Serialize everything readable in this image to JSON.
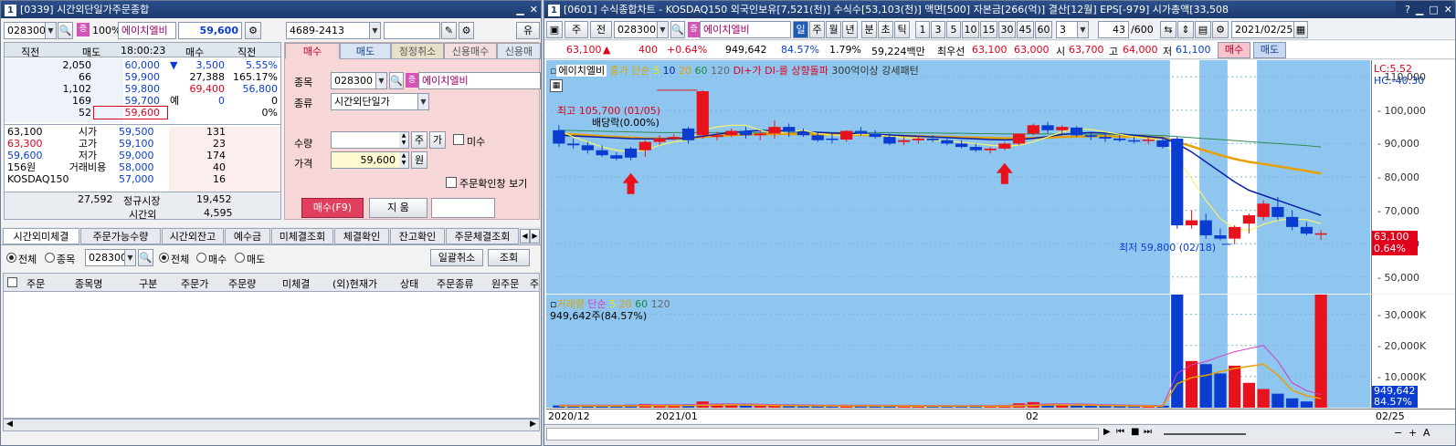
{
  "left": {
    "title": "[0339] 시간외단일가주문종합",
    "code": "028300",
    "pct100": "100%",
    "name": "에이치엘비",
    "price": "59,600",
    "acct": "4689-2413",
    "gubun": "유",
    "hdr": [
      "직전",
      "매도",
      "18:00:23",
      "매수",
      "직전"
    ],
    "ask_rows": [
      [
        "",
        "2,050",
        "60,000",
        "▼",
        "3,500",
        "5.55%"
      ],
      [
        "",
        "66",
        "59,900",
        "",
        "27,388",
        "165.17%"
      ],
      [
        "",
        "1,102",
        "59,800",
        "",
        "69,400",
        "56,800"
      ],
      [
        "",
        "169",
        "59,700",
        "예",
        "0",
        "0"
      ],
      [
        "",
        "52",
        "59,600",
        "",
        "",
        "0%"
      ]
    ],
    "info_rows": [
      [
        "63,100",
        "시가",
        "59,500",
        "131"
      ],
      [
        "63,300",
        "고가",
        "59,100",
        "23"
      ],
      [
        "59,600",
        "저가",
        "59,000",
        "174"
      ],
      [
        "156원",
        "거래비용",
        "58,000",
        "40"
      ],
      [
        "KOSDAQ150",
        "",
        "57,000",
        "16"
      ]
    ],
    "tot_ask": "27,592",
    "tot_label": "정규시장",
    "tot_bid": "19,452",
    "after_label": "시간외",
    "after_val": "4,595",
    "order_tabs": [
      "매수",
      "매도",
      "정정취소",
      "신용매수",
      "신용매"
    ],
    "f_code_label": "종목",
    "f_code": "028300",
    "f_name": "에이치엘비",
    "f_type_label": "종류",
    "f_type": "시간외단일가",
    "f_qty_label": "수량",
    "f_qty_unit": "주",
    "f_qty_ga": "가",
    "f_mi": "미수",
    "f_price_label": "가격",
    "f_price": "59,600",
    "f_price_unit": "원",
    "f_confirm": "주문확인창 보기",
    "buy_btn": "매수(F9)",
    "clear_btn": "지 움",
    "btabs": [
      "시간외미체결",
      "주문가능수량",
      "시간외잔고",
      "예수금",
      "미체결조회",
      "체결확인",
      "잔고확인",
      "주문체결조회"
    ],
    "filter": {
      "all": "전체",
      "stock": "종목",
      "code": "028300",
      "all2": "전체",
      "buy": "매수",
      "sell": "매도",
      "cancel_all": "일괄취소",
      "query": "조회"
    },
    "cols": [
      "주문",
      "종목명",
      "구분",
      "주문가",
      "주문량",
      "미체결",
      "(외)현재가",
      "상태",
      "주문종류",
      "원주문",
      "주"
    ]
  },
  "right": {
    "title": "[0601] 수식종합차트 - KOSDAQ150 외국인보유[7,521(천)] 수식수[53,103(천)] 액면[500] 자본금[266(억)] 결산[12월] EPS[-979] 시가총액[33,508",
    "tb": {
      "ju": "주",
      "jeon": "전",
      "code": "028300",
      "name": "에이치엘비",
      "periods": [
        "일",
        "주",
        "월",
        "년",
        "분",
        "초",
        "틱"
      ],
      "nums": [
        "1",
        "3",
        "5",
        "10",
        "15",
        "30",
        "45",
        "60"
      ],
      "n3": "3",
      "page": "43",
      "pageof": "/600",
      "date": "2021/02/25"
    },
    "q": {
      "price": "63,100",
      "arrow": "▲",
      "chg": "400",
      "chgpct": "+0.64%",
      "vol": "949,642",
      "volpct": "84.57%",
      "r1": "1.79%",
      "amt": "59,224백만",
      "best_label": "최우선",
      "b1": "63,100",
      "b2": "63,000",
      "o_label": "시",
      "o": "63,700",
      "h_label": "고",
      "h": "64,000",
      "l_label": "저",
      "l": "61,100",
      "buy": "매수",
      "sell": "매도"
    },
    "legend": {
      "name": "에이치엘비",
      "close": "종가 단순",
      "ma": [
        "5",
        "10",
        "20",
        "60",
        "120"
      ],
      "di": "DI+가 DI-를 상향돌파",
      "pat": "300억이상 강세패턴"
    },
    "lc": "LC:5.52",
    "hc": "HC:-40.30",
    "ann": {
      "high": "최고 105,700 (01/05)",
      "div": "배당락(0.00%)",
      "low": "최저 59,800 (02/18)",
      "last": "63,100",
      "lastpct": "0.64%"
    },
    "vlegend": {
      "label": "거래량",
      "simple": "단순",
      "ma": [
        "5",
        "20",
        "60",
        "120"
      ],
      "val": "949,642주(84.57%)"
    },
    "vlast": "949,642",
    "vpct": "84.57%",
    "xlabels": [
      "2020/12",
      "2021/01",
      "02",
      "02/25"
    ]
  },
  "chart_data": {
    "type": "candlestick",
    "title": "",
    "ylim": [
      45000,
      115000
    ],
    "y_ticks": [
      50000,
      60000,
      70000,
      80000,
      90000,
      100000,
      110000
    ],
    "y_tick_labels": [
      "50,000",
      "60,000",
      "70,000",
      "80,000",
      "90,000",
      "100,000",
      "110,000"
    ],
    "x_labels": [
      "2020/12",
      "2021/01",
      "02",
      "02/25"
    ],
    "candles": [
      [
        94000,
        95500,
        89000,
        90000
      ],
      [
        90000,
        91500,
        88500,
        89500
      ],
      [
        89500,
        90500,
        87000,
        88000
      ],
      [
        88000,
        89500,
        86000,
        86500
      ],
      [
        86500,
        87500,
        85000,
        85500
      ],
      [
        88500,
        89000,
        85000,
        85800
      ],
      [
        88000,
        91000,
        86000,
        90500
      ],
      [
        90500,
        92500,
        89500,
        91500
      ],
      [
        91500,
        92800,
        91000,
        92000
      ],
      [
        94500,
        95000,
        90000,
        91000
      ],
      [
        92500,
        106000,
        91500,
        105700
      ],
      [
        92000,
        93500,
        91000,
        92500
      ],
      [
        92500,
        94500,
        92000,
        93800
      ],
      [
        93800,
        95000,
        91500,
        92500
      ],
      [
        92500,
        94000,
        91000,
        93000
      ],
      [
        93000,
        97000,
        91500,
        95000
      ],
      [
        95000,
        96000,
        92000,
        93500
      ],
      [
        93500,
        94500,
        92000,
        92500
      ],
      [
        92500,
        93500,
        90500,
        91000
      ],
      [
        91500,
        93000,
        90000,
        91200
      ],
      [
        91200,
        94000,
        90500,
        93800
      ],
      [
        93800,
        95000,
        92500,
        93000
      ],
      [
        93000,
        94000,
        91500,
        92000
      ],
      [
        92000,
        93000,
        89500,
        90000
      ],
      [
        90500,
        92000,
        89500,
        91000
      ],
      [
        91000,
        92500,
        90000,
        91500
      ],
      [
        91500,
        92500,
        90500,
        91000
      ],
      [
        91000,
        92000,
        89500,
        90000
      ],
      [
        90000,
        91000,
        88500,
        89000
      ],
      [
        89000,
        90000,
        87500,
        88000
      ],
      [
        88000,
        89000,
        87000,
        88500
      ],
      [
        88500,
        90500,
        88000,
        90000
      ],
      [
        90000,
        93000,
        89500,
        93000
      ],
      [
        93000,
        96000,
        92500,
        95500
      ],
      [
        95500,
        96500,
        93000,
        94000
      ],
      [
        94000,
        95500,
        93000,
        95000
      ],
      [
        94800,
        95200,
        92000,
        92500
      ],
      [
        92500,
        93000,
        91000,
        92000
      ],
      [
        92000,
        93000,
        90500,
        91500
      ],
      [
        91500,
        92500,
        90500,
        91000
      ],
      [
        91000,
        92000,
        90000,
        90800
      ],
      [
        90800,
        91800,
        89800,
        91200
      ],
      [
        91000,
        92000,
        88500,
        89000
      ],
      [
        91500,
        92000,
        64500,
        65500
      ],
      [
        65500,
        70000,
        64500,
        67000
      ],
      [
        67000,
        69000,
        61500,
        62500
      ],
      [
        62500,
        64500,
        61000,
        61500
      ],
      [
        61500,
        65500,
        59800,
        65000
      ],
      [
        66000,
        69000,
        63000,
        68500
      ],
      [
        68000,
        73000,
        67000,
        72000
      ],
      [
        71000,
        74000,
        67000,
        68000
      ],
      [
        68000,
        70000,
        64000,
        65000
      ],
      [
        65000,
        66500,
        62500,
        63000
      ],
      [
        63000,
        64000,
        61100,
        63100
      ]
    ],
    "ma5": [
      94000,
      92000,
      90500,
      89000,
      88000,
      87500,
      88000,
      89500,
      90500,
      91000,
      94000,
      95000,
      95500,
      95500,
      94000,
      93000,
      93500,
      94000,
      93000,
      92500,
      92500,
      92800,
      92600,
      92200,
      91800,
      91500,
      91000,
      90800,
      90400,
      90000,
      89500,
      89200,
      89500,
      90500,
      92000,
      93500,
      94500,
      94200,
      93500,
      92800,
      92000,
      91500,
      91000,
      85500,
      79500,
      73000,
      67500,
      64500,
      64000,
      65800,
      67000,
      67400,
      67200,
      66000
    ],
    "ma20": [
      93000,
      92800,
      92500,
      92200,
      92000,
      91800,
      91600,
      91500,
      91500,
      91600,
      92000,
      92300,
      92500,
      92700,
      92800,
      92900,
      92900,
      92900,
      92800,
      92700,
      92600,
      92600,
      92500,
      92400,
      92300,
      92200,
      92100,
      92000,
      91900,
      91800,
      91700,
      91600,
      91600,
      91700,
      91800,
      92000,
      92100,
      92200,
      92200,
      92100,
      92000,
      91900,
      91800,
      90500,
      89200,
      87800,
      86500,
      85400,
      84500,
      83900,
      83200,
      82500,
      81800,
      81000
    ],
    "ma60": [
      94000,
      93900,
      93800,
      93700,
      93600,
      93500,
      93400,
      93300,
      93300,
      93300,
      93300,
      93300,
      93300,
      93300,
      93300,
      93300,
      93300,
      93300,
      93300,
      93300,
      93300,
      93300,
      93300,
      93300,
      93200,
      93200,
      93200,
      93100,
      93100,
      93000,
      93000,
      92900,
      92900,
      92900,
      92900,
      92900,
      92900,
      92800,
      92800,
      92700,
      92600,
      92500,
      92400,
      92100,
      91800,
      91500,
      91200,
      90900,
      90600,
      90300,
      90000,
      89700,
      89400,
      89000
    ],
    "ma_other": [
      92500,
      92300,
      92100,
      91900,
      91700,
      91500,
      91400,
      91400,
      91500,
      91700,
      92200,
      92800,
      93300,
      93700,
      93900,
      93900,
      93800,
      93600,
      93400,
      93200,
      93000,
      92900,
      92800,
      92600,
      92400,
      92200,
      92000,
      91800,
      91600,
      91400,
      91200,
      91100,
      91200,
      91600,
      92100,
      92700,
      93100,
      93300,
      93200,
      92900,
      92500,
      92100,
      91700,
      90000,
      87500,
      84500,
      81500,
      78500,
      76000,
      74500,
      73000,
      71500,
      70000,
      68500
    ],
    "volume": [
      7000,
      6500,
      8000,
      9000,
      7500,
      10000,
      12000,
      9500,
      8000,
      11000,
      20000,
      13000,
      10000,
      9000,
      8500,
      9500,
      10500,
      8500,
      7500,
      7000,
      8000,
      9000,
      7500,
      7000,
      6500,
      7000,
      6000,
      6500,
      7500,
      8000,
      7000,
      9000,
      14000,
      18000,
      12000,
      10500,
      9500,
      8000,
      7500,
      6500,
      7000,
      6000,
      6500,
      520000,
      150000,
      140000,
      110000,
      135000,
      80000,
      60000,
      45000,
      30000,
      20000,
      949642
    ],
    "volume_ma": [
      8000,
      8000,
      8000,
      8000,
      8000,
      8200,
      9000,
      9500,
      9500,
      9700,
      11000,
      12000,
      12500,
      12000,
      11000,
      10000,
      9500,
      9000,
      8500,
      8000,
      8000,
      8200,
      8000,
      7700,
      7500,
      7200,
      7000,
      6800,
      6700,
      6800,
      7000,
      7500,
      8500,
      10500,
      12000,
      12500,
      12000,
      11500,
      10000,
      9000,
      8000,
      7500,
      7000,
      110000,
      138000,
      148000,
      165000,
      180000,
      190000,
      200000,
      150000,
      80000,
      55000,
      42000
    ],
    "volume_ylim": [
      0,
      340000
    ],
    "volume_ticks": [
      10000,
      20000,
      30000
    ],
    "volume_tick_labels": [
      "10,000K",
      "20,000K",
      "30,000K"
    ],
    "highlight_cols": [
      43,
      44,
      47,
      48
    ],
    "signal_cols": [
      5,
      31
    ],
    "high_idx": 10,
    "low_idx": 47
  }
}
